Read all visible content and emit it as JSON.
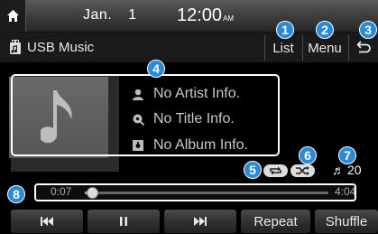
{
  "status_bar": {
    "month": "Jan.",
    "day": "1",
    "time": "12:00",
    "ampm": "AM"
  },
  "title_bar": {
    "source": "USB Music",
    "list_label": "List",
    "menu_label": "Menu"
  },
  "track_info": {
    "artist": "No Artist Info.",
    "title": "No Title Info.",
    "album": "No Album Info."
  },
  "track_count": "20",
  "progress": {
    "elapsed": "0:07",
    "total": "4:04",
    "fraction": 0.03
  },
  "controls": {
    "repeat_label": "Repeat",
    "shuffle_label": "Shuffle"
  },
  "callouts": [
    "1",
    "2",
    "3",
    "4",
    "5",
    "6",
    "7",
    "8"
  ],
  "colors": {
    "callout": "#2a8ad6"
  }
}
